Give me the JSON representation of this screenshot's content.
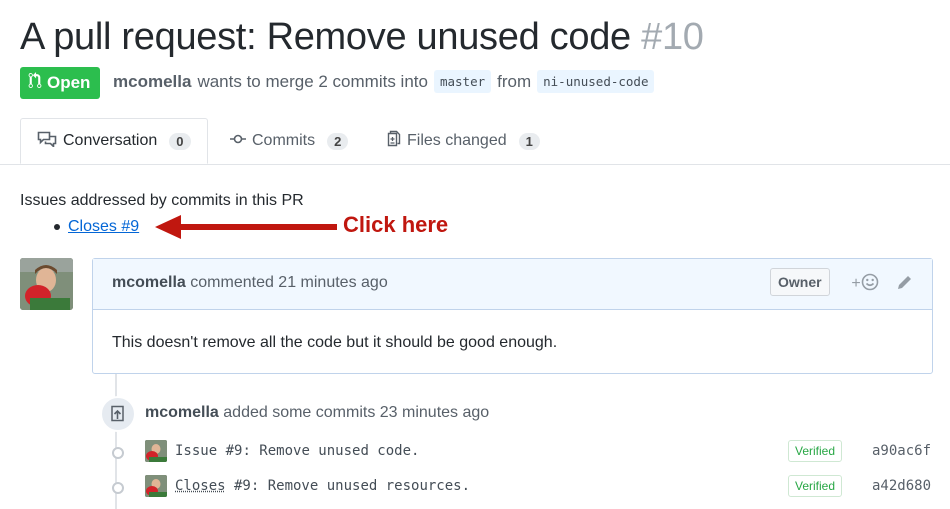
{
  "pr": {
    "title": "A pull request: Remove unused code",
    "number": "#10",
    "state": "Open",
    "author": "mcomella",
    "merge_text": "wants to merge 2 commits into",
    "base_branch": "master",
    "from_text": "from",
    "head_branch": "ni-unused-code"
  },
  "tabs": [
    {
      "label": "Conversation",
      "count": "0",
      "icon": "comment-discussion-icon"
    },
    {
      "label": "Commits",
      "count": "2",
      "icon": "git-commit-icon"
    },
    {
      "label": "Files changed",
      "count": "1",
      "icon": "diff-icon"
    }
  ],
  "issues": {
    "heading": "Issues addressed by commits in this PR",
    "items": [
      "Closes #9"
    ]
  },
  "annotation": {
    "text": "Click here",
    "color": "#c0170f"
  },
  "comment": {
    "author": "mcomella",
    "action": "commented 21 minutes ago",
    "badge": "Owner",
    "reaction_plus": "+",
    "body": "This doesn't remove all the code but it should be good enough."
  },
  "event": {
    "author": "mcomella",
    "action": "added some commits 23 minutes ago"
  },
  "commits": [
    {
      "prefix": "Issue #9",
      "message": ": Remove unused code.",
      "verified": "Verified",
      "sha": "a90ac6f"
    },
    {
      "prefix": "Closes",
      "message": " #9: Remove unused resources.",
      "verified": "Verified",
      "sha": "a42d680"
    }
  ],
  "colors": {
    "open_green": "#2cbe4e",
    "link_blue": "#0366d6",
    "verified_green": "#28a745"
  }
}
